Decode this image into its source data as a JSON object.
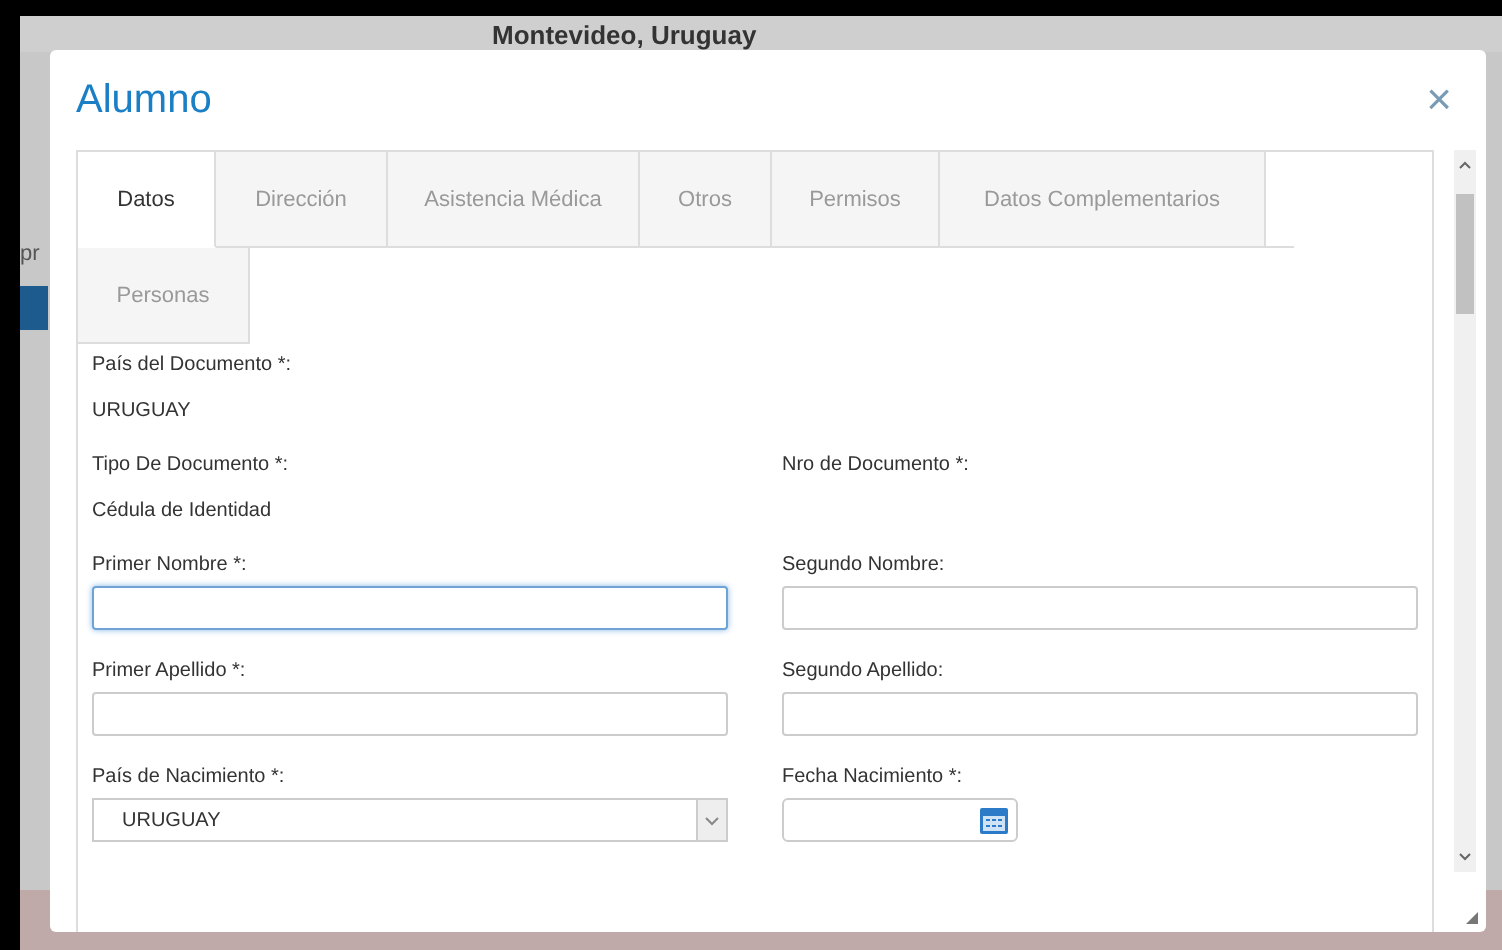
{
  "background": {
    "subtitle": "Montevideo, Uruguay",
    "side_text": "pr"
  },
  "dialog": {
    "title": "Alumno",
    "close": "×"
  },
  "tabs": [
    {
      "label": "Datos",
      "selected": true
    },
    {
      "label": "Dirección",
      "selected": false
    },
    {
      "label": "Asistencia Médica",
      "selected": false
    },
    {
      "label": "Otros",
      "selected": false
    },
    {
      "label": "Permisos",
      "selected": false
    },
    {
      "label": "Datos Complementarios",
      "selected": false
    },
    {
      "label": "Personas",
      "selected": false
    }
  ],
  "rows": [
    [
      {
        "kind": "static",
        "label": "País del Documento *:",
        "value": "URUGUAY"
      }
    ],
    [
      {
        "kind": "static",
        "label": "Tipo De Documento *:",
        "value": "Cédula de Identidad"
      },
      {
        "kind": "static",
        "label": "Nro de Documento *:"
      }
    ],
    [
      {
        "kind": "text",
        "label": "Primer Nombre *:",
        "focused": true
      },
      {
        "kind": "text",
        "label": "Segundo Nombre:",
        "focused": false
      }
    ],
    [
      {
        "kind": "text",
        "label": "Primer Apellido *:",
        "focused": false
      },
      {
        "kind": "text",
        "label": "Segundo Apellido:",
        "focused": false
      }
    ],
    [
      {
        "kind": "select",
        "label": "País de Nacimiento *:",
        "value": "URUGUAY"
      },
      {
        "kind": "date",
        "label": "Fecha Nacimiento *:"
      }
    ]
  ]
}
